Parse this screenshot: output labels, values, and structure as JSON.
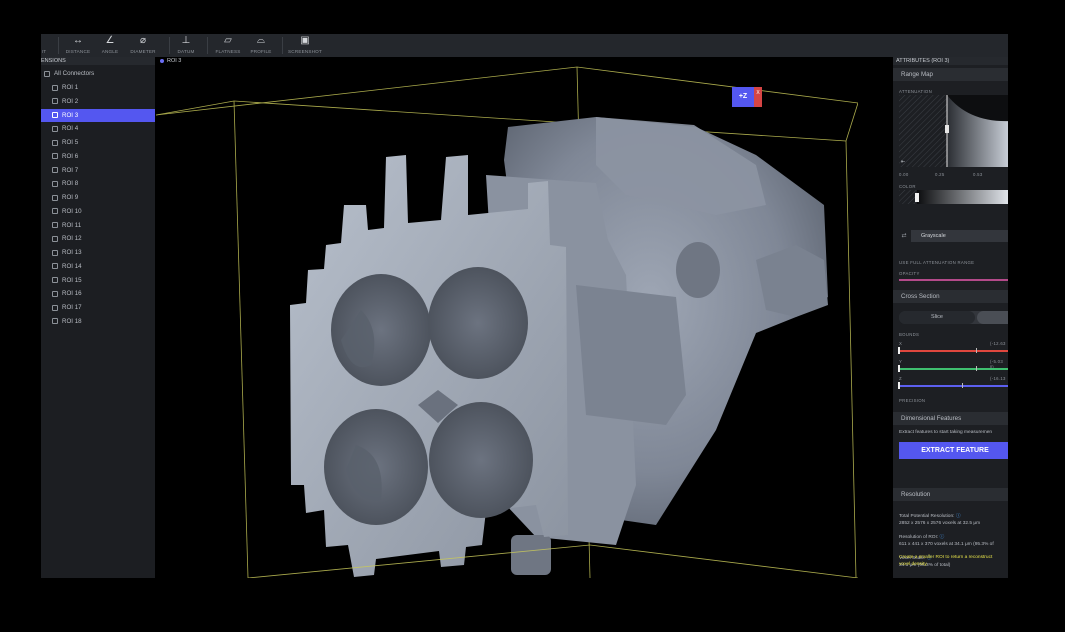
{
  "toolbar": {
    "tools": [
      {
        "icon": "",
        "label": "IT"
      },
      {
        "icon": "↔",
        "label": "DISTANCE"
      },
      {
        "icon": "∠",
        "label": "ANGLE"
      },
      {
        "icon": "⌀",
        "label": "DIAMETER"
      },
      {
        "icon": "⊥",
        "label": "DATUM"
      },
      {
        "icon": "▱",
        "label": "FLATNESS"
      },
      {
        "icon": "⌓",
        "label": "PROFILE"
      },
      {
        "icon": "▣",
        "label": "SCREENSHOT"
      }
    ]
  },
  "sidebar": {
    "header": "ENSIONS",
    "root": "All Connectors",
    "items": [
      "ROI 1",
      "ROI 2",
      "ROI 3",
      "ROI 4",
      "ROI 5",
      "ROI 6",
      "ROI 7",
      "ROI 8",
      "ROI 9",
      "ROI 10",
      "ROI 11",
      "ROI 12",
      "ROI 13",
      "ROI 14",
      "ROI 15",
      "ROI 16",
      "ROI 17",
      "ROI 18"
    ],
    "selected_index": 2
  },
  "viewport": {
    "title": "ROI 3",
    "gizmo": {
      "main": "+Z",
      "side": "X"
    }
  },
  "panel": {
    "title": "ATTRIBUTES (ROI 3)",
    "range_map": {
      "header": "Range Map",
      "attenuation_label": "ATTENUATION",
      "ticks": [
        "0.00",
        "0.25",
        "0.53"
      ],
      "color_label": "COLOR",
      "colormap": "Grayscale",
      "full_range_label": "USE FULL ATTENUATION RANGE",
      "opacity_label": "OPACITY"
    },
    "cross_section": {
      "header": "Cross Section",
      "mode": "Slice",
      "bounds_label": "BOUNDS",
      "axes": [
        {
          "name": "X",
          "value": "(-12.63 "
        },
        {
          "name": "Y",
          "value": "(-5.03 m"
        },
        {
          "name": "Z",
          "value": "(-16.13 "
        }
      ],
      "precision_label": "PRECISION"
    },
    "dimensional": {
      "header": "Dimensional Features",
      "hint": "Extract features to start taking measuremen",
      "button": "EXTRACT FEATURE"
    },
    "resolution": {
      "header": "Resolution",
      "total_label": "Total Potential Resolution:",
      "total_value": "2852 x 2576 x 2576 voxels at 32.5 μm",
      "roi_label": "Resolution of ROI:",
      "roi_value": "611 x 441 x 370 voxels at 34.1 μm (95.3% of",
      "scale_label": "Voxel Scale:",
      "scale_value": "34.1 μm (95.3% of total)",
      "note_line1": "Create a smaller ROI to return a reconstruct",
      "note_line2": "voxel density."
    }
  },
  "colors": {
    "accent": "#5457f0",
    "bbox": "#c9c95a",
    "x_axis": "#e0473e",
    "y_axis": "#3fbf6f",
    "z_axis": "#5c5ff0",
    "note": "#e6e24a"
  }
}
